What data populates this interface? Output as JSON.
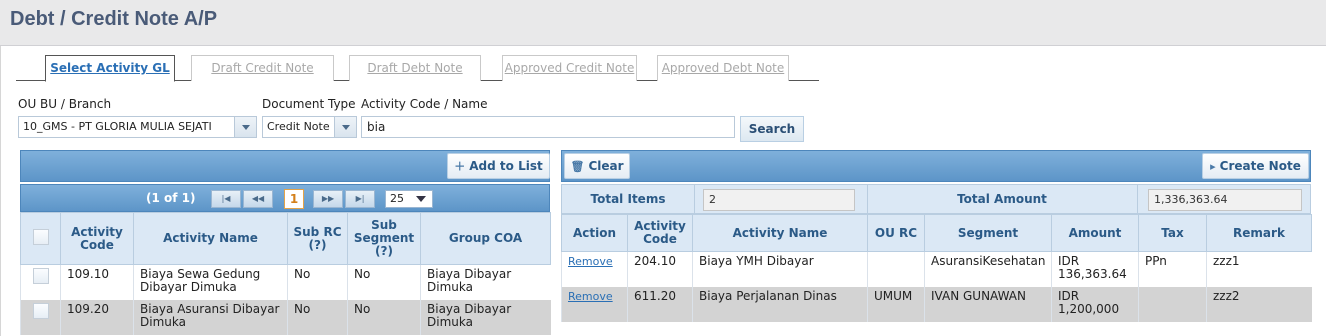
{
  "page": {
    "title": "Debt / Credit Note A/P"
  },
  "tabs": [
    {
      "label": "Select Activity GL",
      "active": true
    },
    {
      "label": "Draft Credit Note",
      "active": false
    },
    {
      "label": "Draft Debt Note",
      "active": false
    },
    {
      "label": "Approved Credit Note",
      "active": false
    },
    {
      "label": "Approved Debt Note",
      "active": false
    }
  ],
  "filters": {
    "ou_label": "OU BU / Branch",
    "ou_value": "10_GMS - PT GLORIA MULIA SEJATI",
    "doctype_label": "Document Type",
    "doctype_value": "Credit Note",
    "activity_label": "Activity Code / Name",
    "activity_value": "bia",
    "search_button": "Search"
  },
  "left_panel": {
    "add_button": "Add to List",
    "pager": {
      "text": "(1 of 1)",
      "current_page": "1",
      "page_size": "25",
      "first": "|◀",
      "prev": "◀◀",
      "next": "▶▶",
      "last": "▶|"
    },
    "columns": [
      "Activity Code",
      "Activity Name",
      "Sub RC (?)",
      "Sub Segment (?)",
      "Group COA"
    ],
    "rows": [
      {
        "code": "109.10",
        "name": "Biaya Sewa Gedung Dibayar Dimuka",
        "sub_rc": "No",
        "sub_segment": "No",
        "group_coa": "Biaya Dibayar Dimuka"
      },
      {
        "code": "109.20",
        "name": "Biaya Asuransi Dibayar Dimuka",
        "sub_rc": "No",
        "sub_segment": "No",
        "group_coa": "Biaya Dibayar Dimuka"
      }
    ]
  },
  "right_panel": {
    "clear_button": "Clear",
    "create_button": "Create Note",
    "total_items_label": "Total Items",
    "total_items_value": "2",
    "total_amount_label": "Total Amount",
    "total_amount_value": "1,336,363.64",
    "columns": [
      "Action",
      "Activity Code",
      "Activity Name",
      "OU RC",
      "Segment",
      "Amount",
      "Tax",
      "Remark"
    ],
    "rows": [
      {
        "action": "Remove",
        "code": "204.10",
        "name": "Biaya YMH Dibayar",
        "ou_rc": "",
        "segment": "AsuransiKesehatan",
        "amount": "IDR 136,363.64",
        "tax": "PPn",
        "remark": "zzz1"
      },
      {
        "action": "Remove",
        "code": "611.20",
        "name": "Biaya Perjalanan Dinas",
        "ou_rc": "UMUM",
        "segment": "IVAN GUNAWAN",
        "amount": "IDR 1,200,000",
        "tax": "",
        "remark": "zzz2"
      }
    ]
  },
  "colors": {
    "accent": "#2a6fb5",
    "bar": "#6ba2d2",
    "header_bg": "#dbe8f5",
    "title": "#4a5b78"
  }
}
